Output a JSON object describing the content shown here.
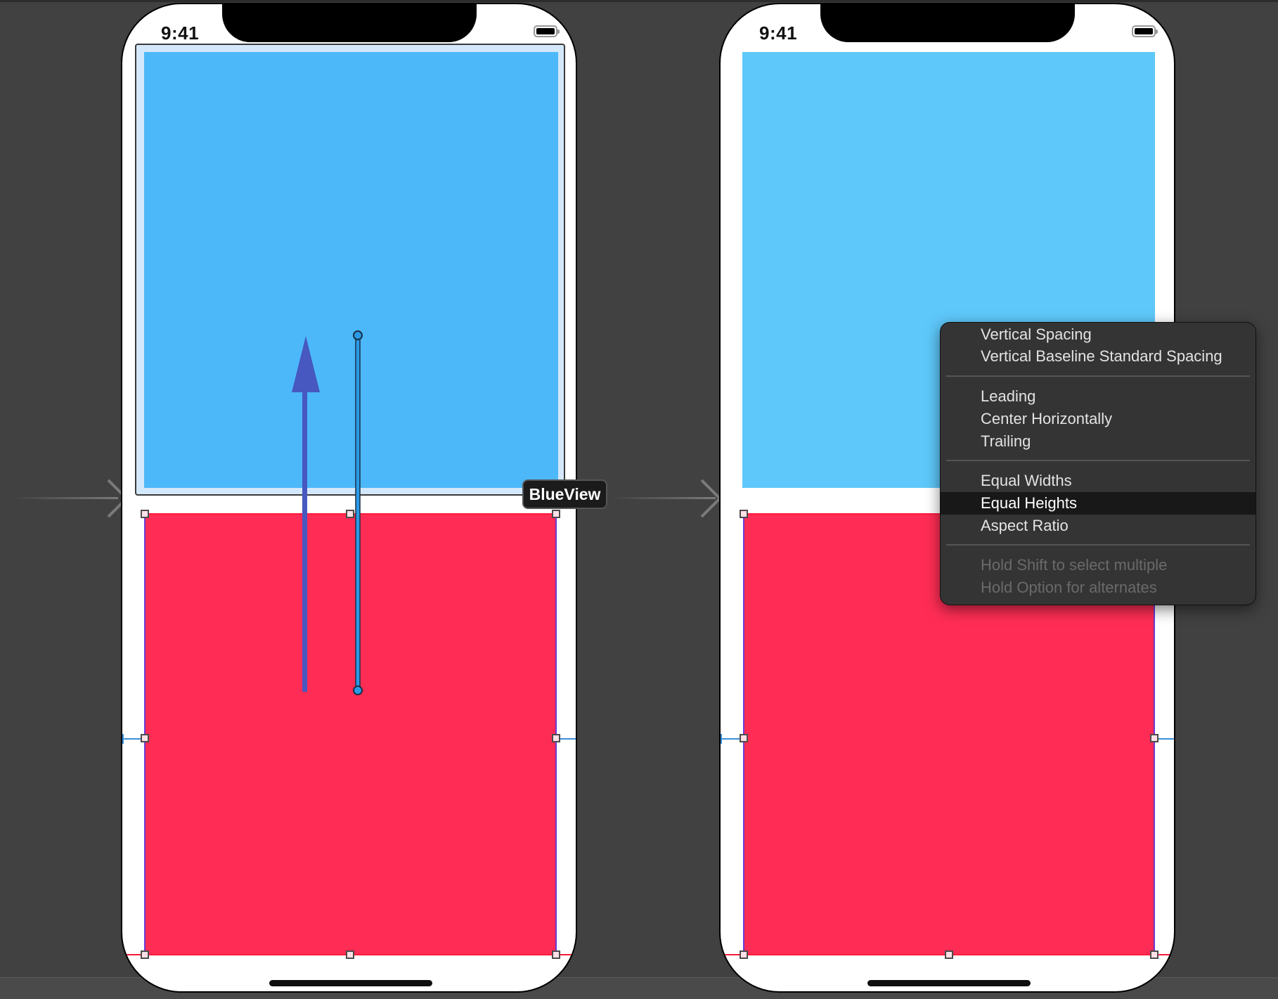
{
  "canvas": {
    "background": "#414141"
  },
  "phones": [
    {
      "id": "left",
      "status_time": "9:41",
      "blue_color": "#4cb8f9",
      "red_color": "#ff2d55",
      "selected": true
    },
    {
      "id": "right",
      "status_time": "9:41",
      "blue_color": "#5ec8fa",
      "red_color": "#ff2d55",
      "selected": false
    }
  ],
  "drag_target_label": "BlueView",
  "context_menu": {
    "groups": [
      {
        "items": [
          {
            "label": "Vertical Spacing"
          },
          {
            "label": "Vertical Baseline Standard Spacing"
          }
        ]
      },
      {
        "items": [
          {
            "label": "Leading"
          },
          {
            "label": "Center Horizontally"
          },
          {
            "label": "Trailing"
          }
        ]
      },
      {
        "items": [
          {
            "label": "Equal Widths"
          },
          {
            "label": "Equal Heights",
            "highlighted": true
          },
          {
            "label": "Aspect Ratio"
          }
        ]
      },
      {
        "items": [
          {
            "label": "Hold Shift to select multiple",
            "disabled": true
          },
          {
            "label": "Hold Option for alternates",
            "disabled": true
          }
        ]
      }
    ]
  }
}
